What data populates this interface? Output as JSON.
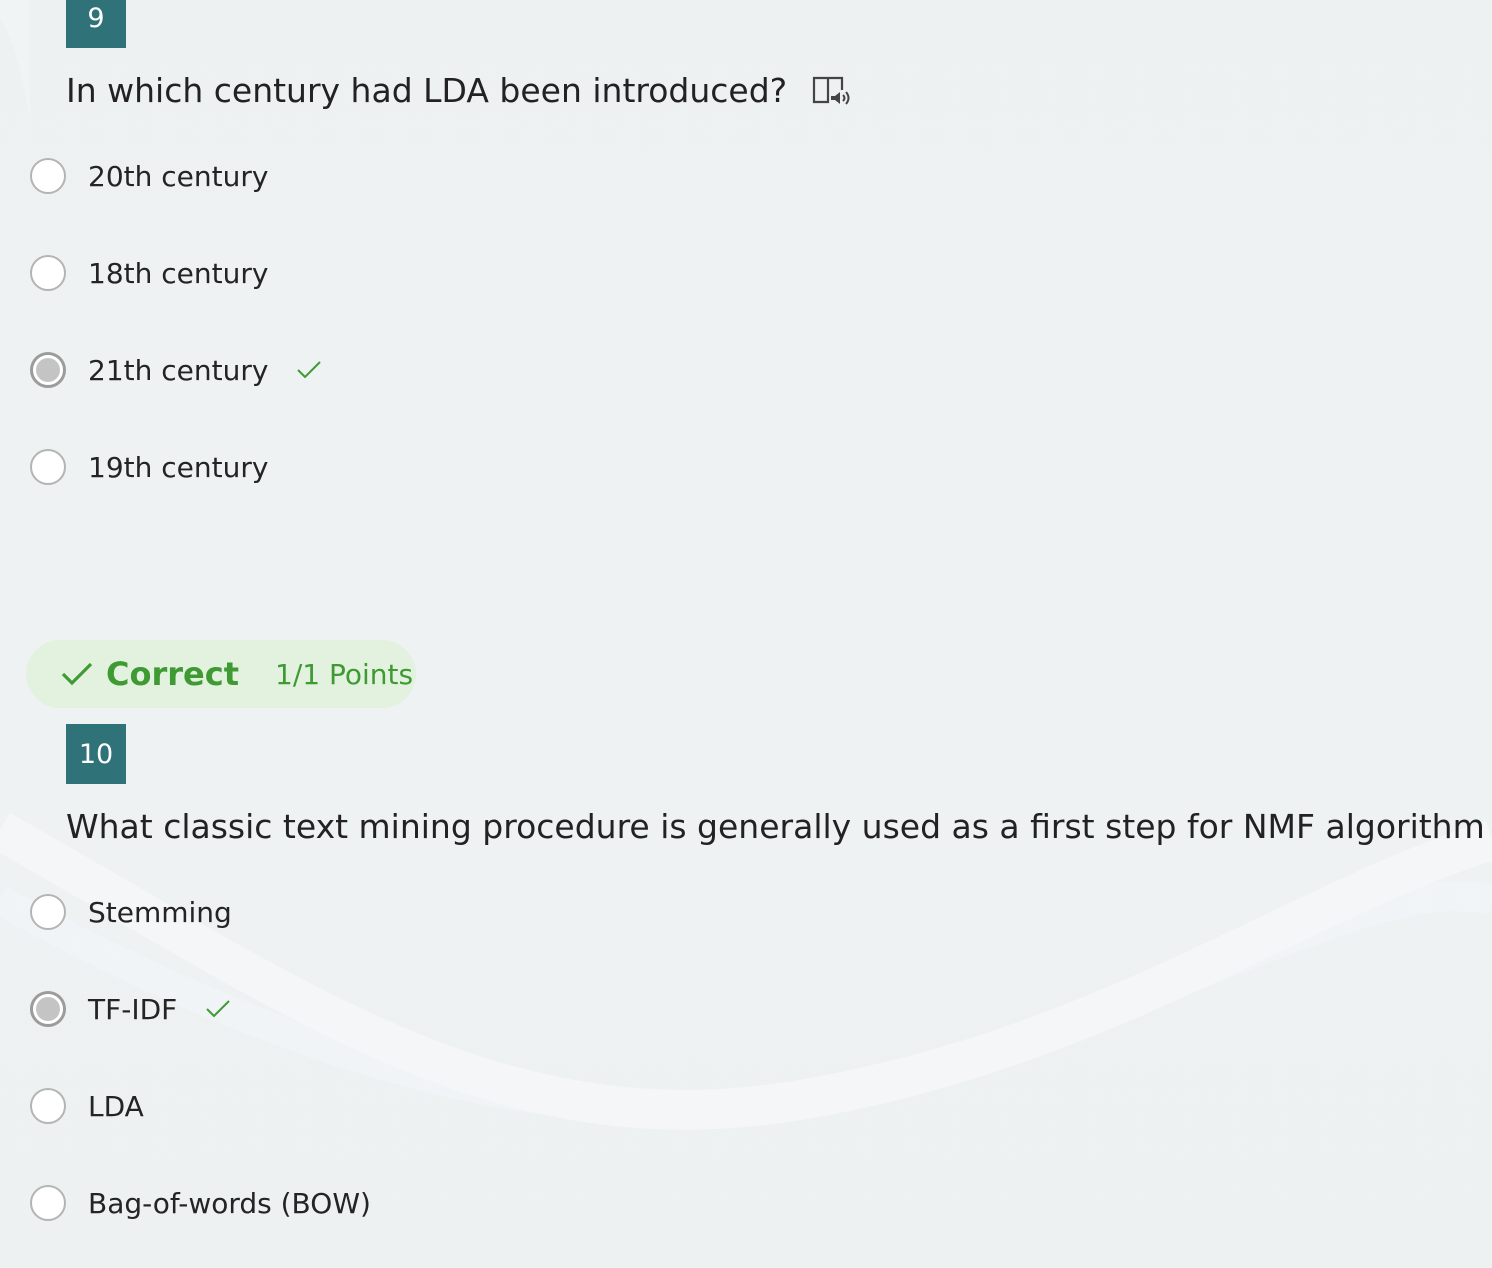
{
  "questions": [
    {
      "number": "9",
      "text": "In which century had LDA been introduced?",
      "reader_icon": "immersive-reader-icon",
      "options": [
        {
          "label": "20th century",
          "selected": false,
          "correct": false
        },
        {
          "label": "18th century",
          "selected": false,
          "correct": false
        },
        {
          "label": "21th century",
          "selected": true,
          "correct": true
        },
        {
          "label": "19th century",
          "selected": false,
          "correct": false
        }
      ]
    },
    {
      "number": "10",
      "text": "What classic text mining procedure is generally used as a first step for NMF algorithm",
      "reader_icon": "immersive-reader-icon",
      "result": {
        "label": "Correct",
        "points": "1/1 Points",
        "color": "#3f9a33",
        "background": "#e2f2df"
      },
      "options": [
        {
          "label": "Stemming",
          "selected": false,
          "correct": false
        },
        {
          "label": "TF-IDF",
          "selected": true,
          "correct": true
        },
        {
          "label": "LDA",
          "selected": false,
          "correct": false
        },
        {
          "label": "Bag-of-words (BOW)",
          "selected": false,
          "correct": false
        }
      ]
    }
  ],
  "colors": {
    "badge": "#2f7378",
    "correct": "#3f9a33"
  }
}
